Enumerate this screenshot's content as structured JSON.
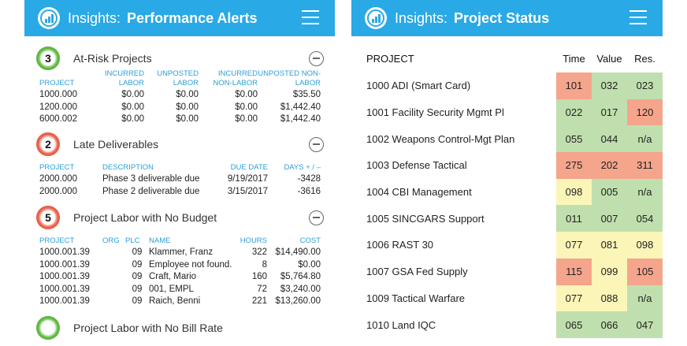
{
  "left": {
    "brand": "Insights:",
    "title": "Performance Alerts",
    "alerts": [
      {
        "count": "3",
        "status": "green",
        "title": "At-Risk Projects",
        "headers": [
          "PROJECT",
          "INCURRED LABOR",
          "UNPOSTED LABOR",
          "INCURRED NON-LABOR",
          "UNPOSTED NON-LABOR"
        ],
        "rows": [
          [
            "1000.000",
            "$0.00",
            "$0.00",
            "$0.00",
            "$35.50"
          ],
          [
            "1200.000",
            "$0.00",
            "$0.00",
            "$0.00",
            "$1,442.40"
          ],
          [
            "6000.002",
            "$0.00",
            "$0.00",
            "$0.00",
            "$1,442.40"
          ]
        ]
      },
      {
        "count": "2",
        "status": "red",
        "title": "Late Deliverables",
        "headers": [
          "PROJECT",
          "DESCRIPTION",
          "DUE DATE",
          "DAYS + / –"
        ],
        "rows": [
          [
            "2000.000",
            "Phase 3 deliverable due",
            "9/19/2017",
            "-3428"
          ],
          [
            "2000.000",
            "Phase 2 deliverable due",
            "3/15/2017",
            "-3616"
          ]
        ]
      },
      {
        "count": "5",
        "status": "red",
        "title": "Project Labor with No Budget",
        "headers": [
          "PROJECT",
          "ORG",
          "PLC",
          "NAME",
          "HOURS",
          "COST"
        ],
        "rows": [
          [
            "1000.001.39",
            "",
            "09",
            "Klammer, Franz",
            "322",
            "$14,490.00"
          ],
          [
            "1000.001.39",
            "",
            "09",
            "Employee not found.",
            "8",
            "$0.00"
          ],
          [
            "1000.001.39",
            "",
            "09",
            "Craft, Mario",
            "160",
            "$5,764.80"
          ],
          [
            "1000.001.39",
            "",
            "09",
            "001, EMPL",
            "72",
            "$3,240.00"
          ],
          [
            "1000.001.39",
            "",
            "09",
            "Raich, Benni",
            "221",
            "$13,260.00"
          ]
        ]
      },
      {
        "count": "",
        "status": "green",
        "title": "Project Labor with No Bill Rate"
      }
    ]
  },
  "right": {
    "brand": "Insights:",
    "title": "Project Status",
    "headers": [
      "PROJECT",
      "Time",
      "Value",
      "Res."
    ],
    "rows": [
      {
        "name": "1000 ADI (Smart Card)",
        "time": "101",
        "value": "032",
        "res": "023",
        "tc": "orange",
        "vc": "green",
        "rc": "green"
      },
      {
        "name": "1001 Facility Security Mgmt Pl",
        "time": "022",
        "value": "017",
        "res": "120",
        "tc": "green",
        "vc": "green",
        "rc": "orange"
      },
      {
        "name": "1002 Weapons Control-Mgt Plan",
        "time": "055",
        "value": "044",
        "res": "n/a",
        "tc": "green",
        "vc": "green",
        "rc": "green"
      },
      {
        "name": "1003 Defense Tactical",
        "time": "275",
        "value": "202",
        "res": "311",
        "tc": "orange",
        "vc": "orange",
        "rc": "orange"
      },
      {
        "name": "1004 CBI Management",
        "time": "098",
        "value": "005",
        "res": "n/a",
        "tc": "yellow",
        "vc": "green",
        "rc": "green"
      },
      {
        "name": "1005 SINCGARS Support",
        "time": "011",
        "value": "007",
        "res": "054",
        "tc": "green",
        "vc": "green",
        "rc": "green"
      },
      {
        "name": "1006 RAST 30",
        "time": "077",
        "value": "081",
        "res": "098",
        "tc": "yellow",
        "vc": "yellow",
        "rc": "yellow"
      },
      {
        "name": "1007 GSA Fed Supply",
        "time": "115",
        "value": "099",
        "res": "105",
        "tc": "orange",
        "vc": "yellow",
        "rc": "orange"
      },
      {
        "name": "1009 Tactical Warfare",
        "time": "077",
        "value": "088",
        "res": "n/a",
        "tc": "yellow",
        "vc": "yellow",
        "rc": "green"
      },
      {
        "name": "1010 Land IQC",
        "time": "065",
        "value": "066",
        "res": "047",
        "tc": "green",
        "vc": "green",
        "rc": "green"
      }
    ]
  },
  "colors": {
    "appbar": "#29a9e6",
    "header_text": "#2b9fd9",
    "green_cell": "#c0dfae",
    "yellow_cell": "#fbf6b8",
    "orange_cell": "#f4a58c"
  }
}
